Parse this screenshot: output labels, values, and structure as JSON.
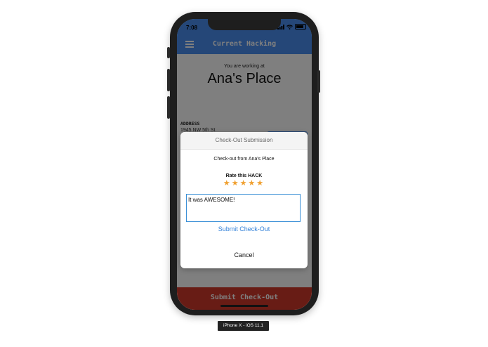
{
  "status_bar": {
    "time": "7:08"
  },
  "app": {
    "title": "Current Hacking"
  },
  "main": {
    "working_label": "You are working at",
    "place_name": "Ana's Place",
    "address_label": "ADDRESS",
    "address_value": "1945 NW 5th St",
    "submit_bar_label": "Submit Check-Out"
  },
  "dialog": {
    "title": "Check-Out Submission",
    "subtitle": "Check-out from Ana's Place",
    "rate_label": "Rate this HACK",
    "rating": 5,
    "rating_max": 5,
    "stars": "★★★★★",
    "comment_value": "It was AWESOME!",
    "submit_label": "Submit Check-Out",
    "cancel_label": "Cancel"
  },
  "device_label": "iPhone X - iOS 11.1",
  "colors": {
    "header": "#4a8ff0",
    "submit_bar": "#d0392b",
    "star": "#f0a030",
    "link": "#2f7fd8"
  }
}
